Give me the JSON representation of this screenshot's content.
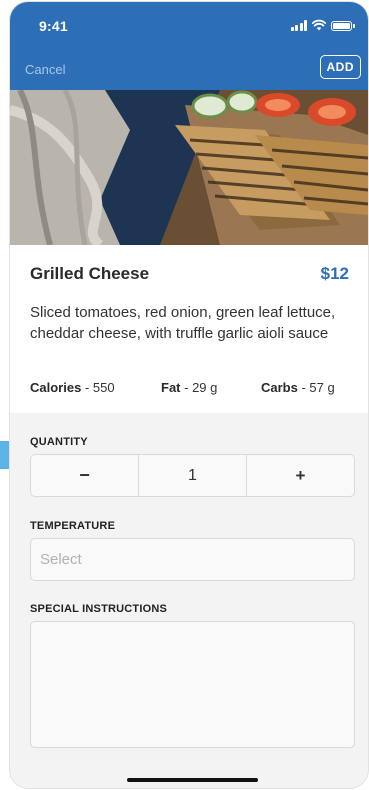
{
  "status_bar": {
    "time": "9:41"
  },
  "nav": {
    "cancel_label": "Cancel",
    "add_label": "ADD"
  },
  "item": {
    "name": "Grilled Cheese",
    "price": "$12",
    "description": "Sliced tomatoes, red onion, green leaf lettuce, cheddar cheese, with truffle garlic aioli sauce",
    "nutrition": [
      {
        "label": "Calories",
        "value": "- 550"
      },
      {
        "label": "Fat",
        "value": "- 29 g"
      },
      {
        "label": "Carbs",
        "value": "- 57 g"
      }
    ]
  },
  "form": {
    "quantity": {
      "label": "QUANTITY",
      "decrement": "−",
      "value": "1",
      "increment": "+"
    },
    "temperature": {
      "label": "TEMPERATURE",
      "placeholder": "Select"
    },
    "special_instructions": {
      "label": "SPECIAL INSTRUCTIONS",
      "value": ""
    }
  },
  "colors": {
    "brand_blue": "#2d6fb6",
    "accent_tab": "#5cb3e6"
  }
}
